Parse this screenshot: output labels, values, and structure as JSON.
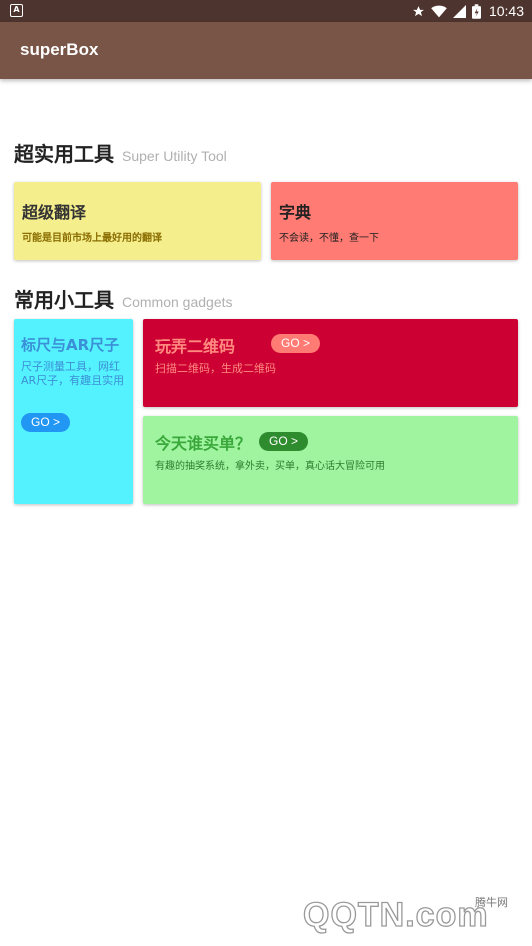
{
  "status_bar": {
    "time": "10:43",
    "left_icon": "A",
    "icons": [
      "star-icon",
      "wifi-icon",
      "signal-icon",
      "battery-icon"
    ]
  },
  "app_bar": {
    "title": "superBox"
  },
  "sections": [
    {
      "title": "超实用工具",
      "subtitle": "Super Utility Tool"
    },
    {
      "title": "常用小工具",
      "subtitle": "Common gadgets"
    }
  ],
  "cards": {
    "translate": {
      "title": "超级翻译",
      "desc": "可能是目前市场上最好用的翻译",
      "color": "#f4ee8d"
    },
    "dictionary": {
      "title": "字典",
      "desc": "不会读，不懂，查一下",
      "color": "#ff7b73"
    },
    "ruler": {
      "title": "标尺与AR尺子",
      "desc": "尺子测量工具，网红AR尺子，有趣且实用",
      "go": "GO >",
      "color": "#54f2ff"
    },
    "qrcode": {
      "title": "玩弄二维码",
      "desc": "扫描二维码，生成二维码",
      "go": "GO >",
      "color": "#cc0033"
    },
    "whopays": {
      "title": "今天谁买单？",
      "desc": "有趣的抽奖系统，拿外卖，买单，真心话大冒险可用",
      "go": "GO >",
      "color": "#a0f4a0"
    }
  },
  "watermark": {
    "logo": "QQTN.com",
    "sub": "腾牛网"
  }
}
